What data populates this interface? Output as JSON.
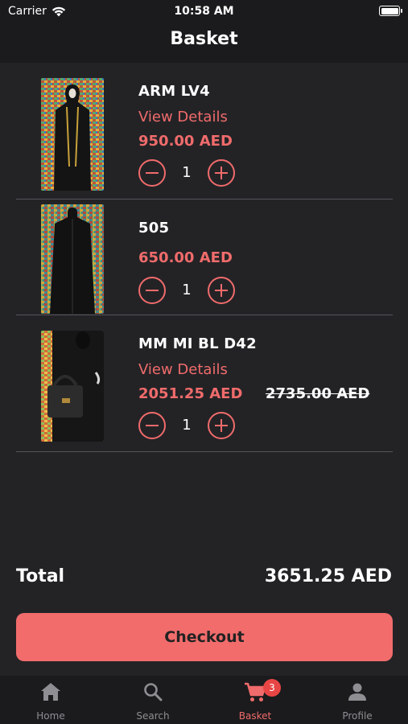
{
  "status_bar": {
    "carrier": "Carrier",
    "time": "10:58 AM"
  },
  "header": {
    "title": "Basket"
  },
  "items": [
    {
      "name": "ARM LV4",
      "details_label": "View Details",
      "price": "950.00 AED",
      "old_price": "",
      "quantity": "1",
      "image": "abaya-gold-trim-image"
    },
    {
      "name": "505",
      "details_label": "",
      "price": "650.00 AED",
      "old_price": "",
      "quantity": "1",
      "image": "abaya-plain-image"
    },
    {
      "name": "MM MI BL D42",
      "details_label": "View Details",
      "price": "2051.25 AED",
      "old_price": "2735.00 AED",
      "quantity": "1",
      "image": "abaya-with-handbag-image"
    }
  ],
  "summary": {
    "total_label": "Total",
    "total_value": "3651.25 AED"
  },
  "checkout": {
    "label": "Checkout"
  },
  "tabs": [
    {
      "label": "Home",
      "icon": "home-icon",
      "active": false
    },
    {
      "label": "Search",
      "icon": "search-icon",
      "active": false
    },
    {
      "label": "Basket",
      "icon": "cart-icon",
      "active": true,
      "badge": "3"
    },
    {
      "label": "Profile",
      "icon": "person-icon",
      "active": false
    }
  ],
  "colors": {
    "accent": "#f06b6b",
    "background": "#232326",
    "bar": "#1b1b1d",
    "badge": "#e84545"
  }
}
